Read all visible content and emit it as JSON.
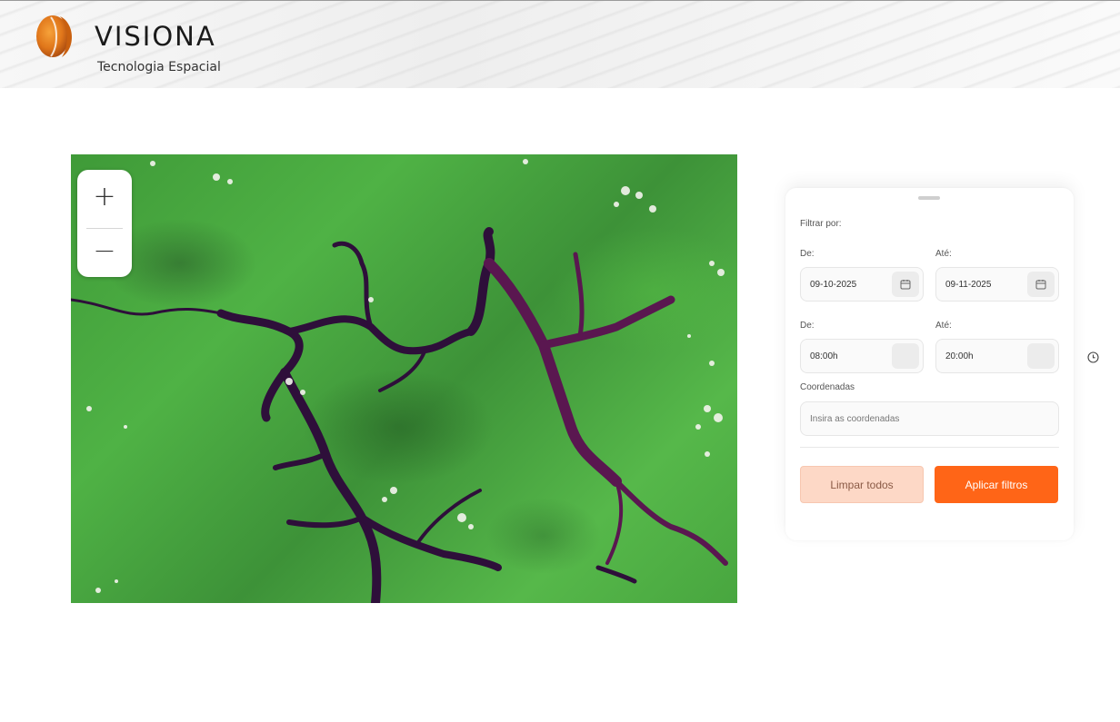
{
  "header": {
    "brand_name": "VISIONA",
    "brand_subtitle": "Tecnologia Espacial",
    "logo_icon": "visiona-logo-icon",
    "accent_color": "#ff6517"
  },
  "map": {
    "zoom_in_label": "+",
    "zoom_out_label": "−",
    "imagery": "satellite-image"
  },
  "filter": {
    "title": "Filtrar por:",
    "date_from_label": "De:",
    "date_to_label": "Até:",
    "date_from_value": "09-10-2025",
    "date_to_value": "09-11-2025",
    "time_from_label": "De:",
    "time_to_label": "Até:",
    "time_from_value": "08:00h",
    "time_to_value": "20:00h",
    "coords_label": "Coordenadas",
    "coords_placeholder": "Insira as coordenadas",
    "clear_button": "Limpar todos",
    "apply_button": "Aplicar filtros",
    "calendar_icon": "calendar-icon",
    "clock_icon": "clock-icon"
  }
}
